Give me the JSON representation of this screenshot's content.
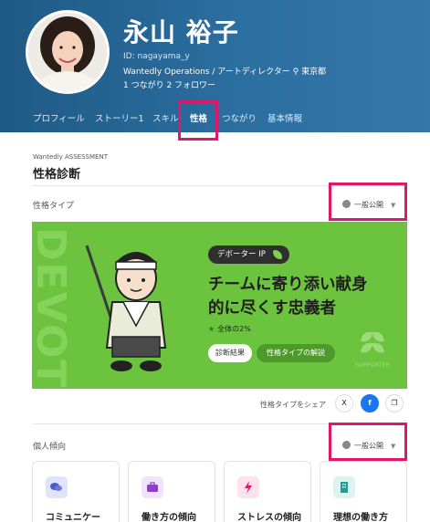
{
  "profile": {
    "name": "永山 裕子",
    "id": "ID: nagayama_y",
    "company": "Wantedly Operations",
    "role": " / アートディレクター",
    "location": "東京都",
    "connections": "1 つながり 2 フォロワー"
  },
  "tabs": [
    "プロフィール",
    "ストーリー1",
    "スキル",
    "性格",
    "つながり",
    "基本情報"
  ],
  "active_tab": "性格",
  "assessment": {
    "label": "Wantedly ASSESSMENT",
    "title": "性格診断"
  },
  "personality_type": {
    "section_label": "性格タイプ",
    "visibility": "一般公開",
    "bg_word": "DEVOTEE",
    "badge": "デボーター IP",
    "catch_line1": "チームに寄り添い献身",
    "catch_line2": "的に尽くす忠義者",
    "percentage": "全体の2%",
    "button_result": "診断結果",
    "button_explain": "性格タイプの解説",
    "supporter_label": "SUPPORTER"
  },
  "share": {
    "label": "性格タイプをシェア",
    "x": "X",
    "fb": "f",
    "copy": "❐"
  },
  "tendency": {
    "section_label": "個人傾向",
    "visibility": "一般公開",
    "cards": [
      {
        "title": "コミュニケー",
        "color": "#dfe3fb",
        "icon": "chat-icon"
      },
      {
        "title": "働き方の傾向",
        "color": "#f0e3fb",
        "icon": "briefcase-icon"
      },
      {
        "title": "ストレスの傾向",
        "color": "#fde2ee",
        "icon": "bolt-icon"
      },
      {
        "title": "理想の働き方",
        "color": "#ddf3f1",
        "icon": "building-icon"
      }
    ]
  },
  "colors": {
    "header": "#2b6ea0",
    "banner": "#6cc43e",
    "highlight": "#e0166b"
  }
}
